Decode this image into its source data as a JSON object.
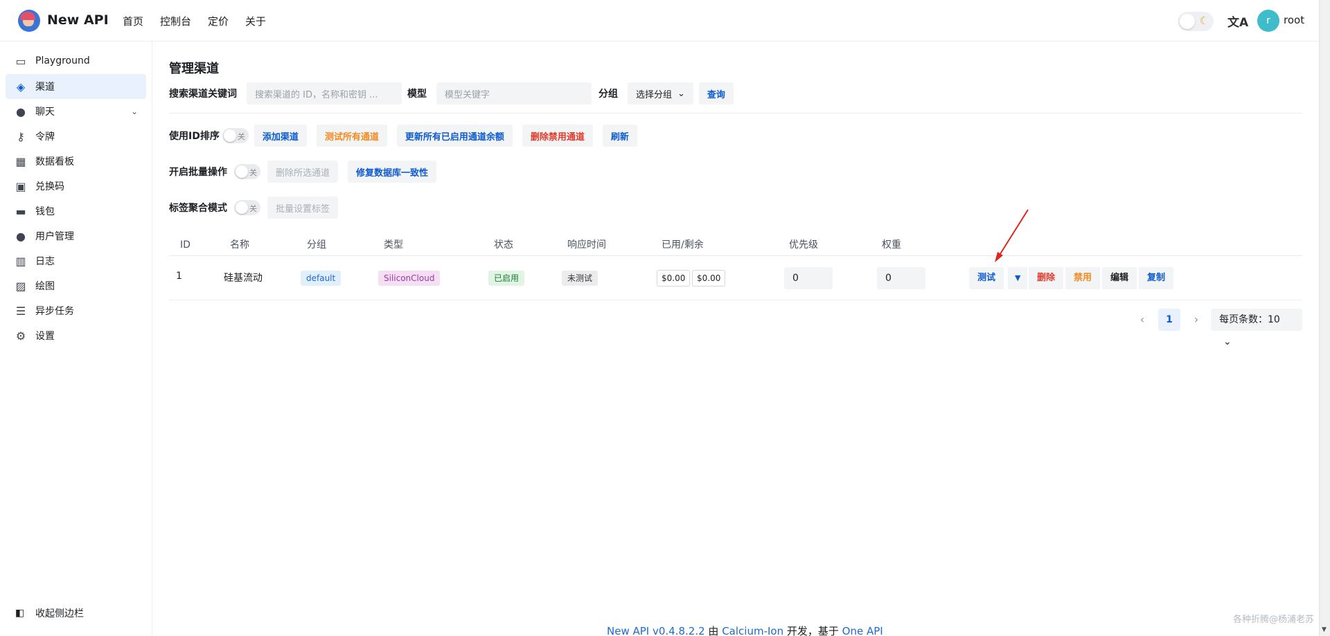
{
  "header": {
    "brand": "New API",
    "nav": [
      "首页",
      "控制台",
      "定价",
      "关于"
    ],
    "avatar_letter": "r",
    "username": "root",
    "theme_icon": "moon-icon",
    "lang_icon": "translate-icon"
  },
  "sidebar": {
    "items": [
      {
        "label": "Playground",
        "icon": "chat-square-icon"
      },
      {
        "label": "渠道",
        "icon": "layers-icon"
      },
      {
        "label": "聊天",
        "icon": "chat-bubble-icon"
      },
      {
        "label": "令牌",
        "icon": "key-icon"
      },
      {
        "label": "数据看板",
        "icon": "calendar-clock-icon"
      },
      {
        "label": "兑换码",
        "icon": "gift-icon"
      },
      {
        "label": "钱包",
        "icon": "wallet-icon"
      },
      {
        "label": "用户管理",
        "icon": "user-icon"
      },
      {
        "label": "日志",
        "icon": "bar-chart-icon"
      },
      {
        "label": "绘图",
        "icon": "image-icon"
      },
      {
        "label": "异步任务",
        "icon": "checklist-icon"
      },
      {
        "label": "设置",
        "icon": "gear-icon"
      }
    ],
    "active_index": 1,
    "collapse_label": "收起侧边栏"
  },
  "page": {
    "title": "管理渠道",
    "search": {
      "keyword_label": "搜索渠道关键词",
      "keyword_placeholder": "搜索渠道的 ID，名称和密钥 ...",
      "model_label": "模型",
      "model_placeholder": "模型关键字",
      "group_label": "分组",
      "group_select": "选择分组",
      "query_button": "查询"
    },
    "toolbar1": {
      "sort_label": "使用ID排序",
      "switch_off": "关",
      "add": "添加渠道",
      "test_all": "测试所有通道",
      "update_balance": "更新所有已启用通道余额",
      "delete_disabled": "删除禁用通道",
      "refresh": "刷新"
    },
    "toolbar2": {
      "batch_label": "开启批量操作",
      "switch_off": "关",
      "delete_selected": "删除所选通道",
      "fix_db": "修复数据库一致性"
    },
    "toolbar3": {
      "tag_label": "标签聚合模式",
      "switch_off": "关",
      "batch_tag": "批量设置标签"
    }
  },
  "table": {
    "columns": [
      "ID",
      "名称",
      "分组",
      "类型",
      "状态",
      "响应时间",
      "已用/剩余",
      "优先级",
      "权重"
    ],
    "rows": [
      {
        "id": "1",
        "name": "硅基流动",
        "group": "default",
        "type": "SiliconCloud",
        "status": "已启用",
        "response": "未测试",
        "used": "$0.00",
        "remaining": "$0.00",
        "priority": "0",
        "weight": "0",
        "actions": {
          "test": "测试",
          "delete": "删除",
          "disable": "禁用",
          "edit": "编辑",
          "copy": "复制"
        }
      }
    ]
  },
  "pagination": {
    "current": "1",
    "page_size": "每页条数：10"
  },
  "footer": {
    "version": "New API v0.4.8.2.2",
    "by": " 由 ",
    "author": "Calcium-Ion",
    "dev": " 开发，基于 ",
    "base": "One API"
  },
  "watermark": "各种折腾@杨浦老苏",
  "colors": {
    "primary": "#0d5bd1",
    "warning": "#f58a1f",
    "danger": "#e33a2b",
    "annotation_arrow": "#e0241b"
  }
}
